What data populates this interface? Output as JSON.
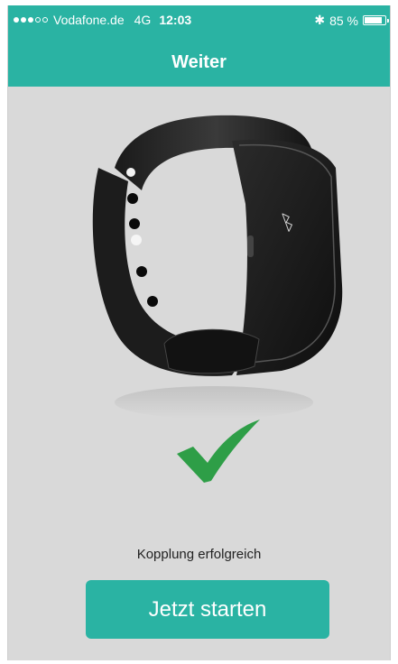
{
  "status_bar": {
    "carrier": "Vodafone.de",
    "network": "4G",
    "time": "12:03",
    "battery_percent": "85 %",
    "battery_level": 0.85,
    "signal_bars_filled": 3,
    "signal_bars_total": 5,
    "icons": [
      "signal-dots-icon",
      "bluetooth-icon",
      "battery-icon"
    ]
  },
  "header": {
    "title": "Weiter"
  },
  "main": {
    "image": "fitness-tracker-image",
    "status_icon": "checkmark-icon",
    "message": "Kopplung erfolgreich",
    "start_button_label": "Jetzt starten"
  },
  "colors": {
    "accent": "#2ab3a3",
    "background": "#d9d9d9",
    "check": "#2e9e47"
  }
}
